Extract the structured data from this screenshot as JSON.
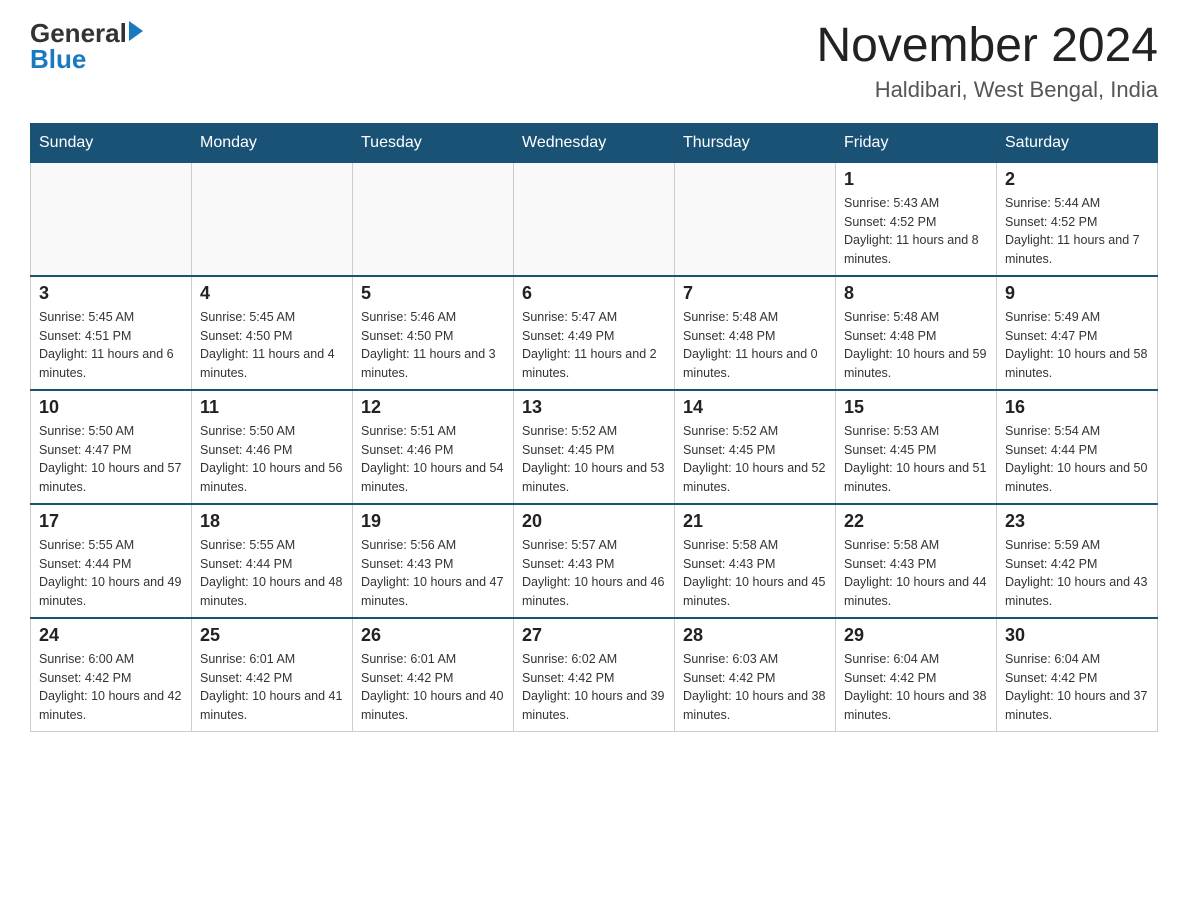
{
  "header": {
    "logo_general": "General",
    "logo_blue": "Blue",
    "main_title": "November 2024",
    "subtitle": "Haldibari, West Bengal, India"
  },
  "weekdays": [
    "Sunday",
    "Monday",
    "Tuesday",
    "Wednesday",
    "Thursday",
    "Friday",
    "Saturday"
  ],
  "weeks": [
    [
      {
        "day": "",
        "info": ""
      },
      {
        "day": "",
        "info": ""
      },
      {
        "day": "",
        "info": ""
      },
      {
        "day": "",
        "info": ""
      },
      {
        "day": "",
        "info": ""
      },
      {
        "day": "1",
        "info": "Sunrise: 5:43 AM\nSunset: 4:52 PM\nDaylight: 11 hours and 8 minutes."
      },
      {
        "day": "2",
        "info": "Sunrise: 5:44 AM\nSunset: 4:52 PM\nDaylight: 11 hours and 7 minutes."
      }
    ],
    [
      {
        "day": "3",
        "info": "Sunrise: 5:45 AM\nSunset: 4:51 PM\nDaylight: 11 hours and 6 minutes."
      },
      {
        "day": "4",
        "info": "Sunrise: 5:45 AM\nSunset: 4:50 PM\nDaylight: 11 hours and 4 minutes."
      },
      {
        "day": "5",
        "info": "Sunrise: 5:46 AM\nSunset: 4:50 PM\nDaylight: 11 hours and 3 minutes."
      },
      {
        "day": "6",
        "info": "Sunrise: 5:47 AM\nSunset: 4:49 PM\nDaylight: 11 hours and 2 minutes."
      },
      {
        "day": "7",
        "info": "Sunrise: 5:48 AM\nSunset: 4:48 PM\nDaylight: 11 hours and 0 minutes."
      },
      {
        "day": "8",
        "info": "Sunrise: 5:48 AM\nSunset: 4:48 PM\nDaylight: 10 hours and 59 minutes."
      },
      {
        "day": "9",
        "info": "Sunrise: 5:49 AM\nSunset: 4:47 PM\nDaylight: 10 hours and 58 minutes."
      }
    ],
    [
      {
        "day": "10",
        "info": "Sunrise: 5:50 AM\nSunset: 4:47 PM\nDaylight: 10 hours and 57 minutes."
      },
      {
        "day": "11",
        "info": "Sunrise: 5:50 AM\nSunset: 4:46 PM\nDaylight: 10 hours and 56 minutes."
      },
      {
        "day": "12",
        "info": "Sunrise: 5:51 AM\nSunset: 4:46 PM\nDaylight: 10 hours and 54 minutes."
      },
      {
        "day": "13",
        "info": "Sunrise: 5:52 AM\nSunset: 4:45 PM\nDaylight: 10 hours and 53 minutes."
      },
      {
        "day": "14",
        "info": "Sunrise: 5:52 AM\nSunset: 4:45 PM\nDaylight: 10 hours and 52 minutes."
      },
      {
        "day": "15",
        "info": "Sunrise: 5:53 AM\nSunset: 4:45 PM\nDaylight: 10 hours and 51 minutes."
      },
      {
        "day": "16",
        "info": "Sunrise: 5:54 AM\nSunset: 4:44 PM\nDaylight: 10 hours and 50 minutes."
      }
    ],
    [
      {
        "day": "17",
        "info": "Sunrise: 5:55 AM\nSunset: 4:44 PM\nDaylight: 10 hours and 49 minutes."
      },
      {
        "day": "18",
        "info": "Sunrise: 5:55 AM\nSunset: 4:44 PM\nDaylight: 10 hours and 48 minutes."
      },
      {
        "day": "19",
        "info": "Sunrise: 5:56 AM\nSunset: 4:43 PM\nDaylight: 10 hours and 47 minutes."
      },
      {
        "day": "20",
        "info": "Sunrise: 5:57 AM\nSunset: 4:43 PM\nDaylight: 10 hours and 46 minutes."
      },
      {
        "day": "21",
        "info": "Sunrise: 5:58 AM\nSunset: 4:43 PM\nDaylight: 10 hours and 45 minutes."
      },
      {
        "day": "22",
        "info": "Sunrise: 5:58 AM\nSunset: 4:43 PM\nDaylight: 10 hours and 44 minutes."
      },
      {
        "day": "23",
        "info": "Sunrise: 5:59 AM\nSunset: 4:42 PM\nDaylight: 10 hours and 43 minutes."
      }
    ],
    [
      {
        "day": "24",
        "info": "Sunrise: 6:00 AM\nSunset: 4:42 PM\nDaylight: 10 hours and 42 minutes."
      },
      {
        "day": "25",
        "info": "Sunrise: 6:01 AM\nSunset: 4:42 PM\nDaylight: 10 hours and 41 minutes."
      },
      {
        "day": "26",
        "info": "Sunrise: 6:01 AM\nSunset: 4:42 PM\nDaylight: 10 hours and 40 minutes."
      },
      {
        "day": "27",
        "info": "Sunrise: 6:02 AM\nSunset: 4:42 PM\nDaylight: 10 hours and 39 minutes."
      },
      {
        "day": "28",
        "info": "Sunrise: 6:03 AM\nSunset: 4:42 PM\nDaylight: 10 hours and 38 minutes."
      },
      {
        "day": "29",
        "info": "Sunrise: 6:04 AM\nSunset: 4:42 PM\nDaylight: 10 hours and 38 minutes."
      },
      {
        "day": "30",
        "info": "Sunrise: 6:04 AM\nSunset: 4:42 PM\nDaylight: 10 hours and 37 minutes."
      }
    ]
  ]
}
